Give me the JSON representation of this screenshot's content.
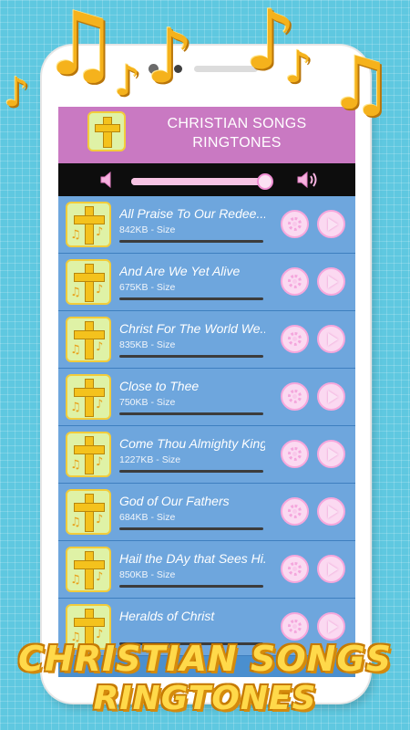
{
  "app": {
    "title_line1": "CHRISTIAN SONGS",
    "title_line2": "RINGTONES",
    "brand_line1": "CHRISTIAN SONGS",
    "brand_line2": "RINGTONES"
  },
  "player": {
    "volume_fraction": 0.98
  },
  "songs": [
    {
      "title": "All Praise To Our Redee...",
      "size": "842KB - Size"
    },
    {
      "title": "And Are We Yet Alive",
      "size": "675KB - Size"
    },
    {
      "title": "Christ For The World We...",
      "size": "835KB - Size"
    },
    {
      "title": "Close to Thee",
      "size": "750KB - Size"
    },
    {
      "title": "Come Thou Almighty King",
      "size": "1227KB - Size"
    },
    {
      "title": "God of Our Fathers",
      "size": "684KB - Size"
    },
    {
      "title": "Hail the DAy that Sees Hi...",
      "size": "850KB - Size"
    },
    {
      "title": "Heralds of Christ",
      "size": ""
    }
  ],
  "colors": {
    "background": "#5fc8e0",
    "header": "#c979c2",
    "list": "#6ea6dd",
    "accent_pink": "#f6a7dc",
    "gold": "#f5b21c"
  },
  "icons": [
    "music-note-icon",
    "cross-icon",
    "volume-low-icon",
    "volume-high-icon",
    "settings-gear-icon",
    "play-icon"
  ]
}
